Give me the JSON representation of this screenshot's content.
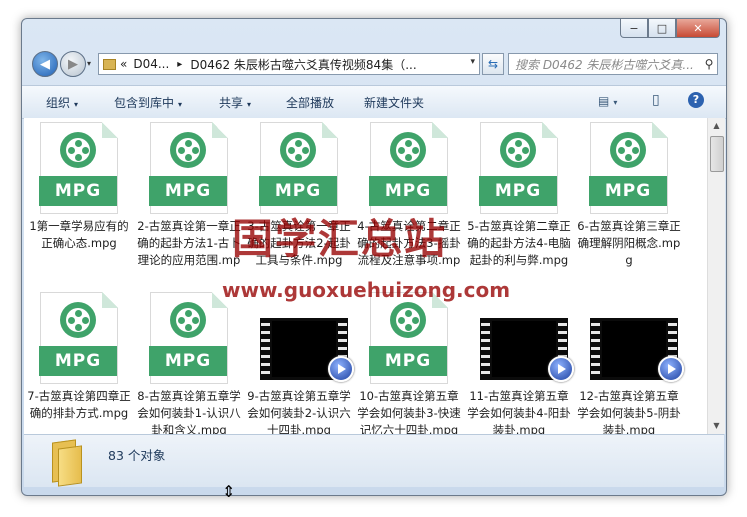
{
  "window": {
    "minimize": "−",
    "maximize": "□",
    "close": "✕"
  },
  "nav": {
    "back": "◀",
    "forward": "▶",
    "address_prefix": "«",
    "address_crumb1": "D04...",
    "address_sep": "▸",
    "address_crumb2": "D0462 朱辰彬古噬六爻真传视频84集（...",
    "address_dropdown": "▾",
    "refresh": "⇆",
    "search_placeholder": "搜索 D0462 朱辰彬古噬六爻真...",
    "search_icon": "magnifier-icon"
  },
  "toolbar": {
    "organize": "组织",
    "include_library": "包含到库中",
    "share": "共享",
    "play_all": "全部播放",
    "new_folder": "新建文件夹",
    "caret": "▾",
    "view_icon": "▤",
    "pane_icon": "▯",
    "help_icon": "?"
  },
  "files": [
    {
      "name": "1第一章学易应有的正确心态.mpg",
      "type": "MPG"
    },
    {
      "name": "2-古筮真诠第一章正确的起卦方法1-古卜理论的应用范围.mpg",
      "type": "MPG"
    },
    {
      "name": "3-古筮真诠第一章正确的起卦方法2-起卦工具与条件.mpg",
      "type": "MPG"
    },
    {
      "name": "4-古筮真诠第二章正确的起卦方法3-摇卦流程及注意事项.mpg",
      "type": "MPG"
    },
    {
      "name": "5-古筮真诠第二章正确的起卦方法4-电脑起卦的利与弊.mpg",
      "type": "MPG"
    },
    {
      "name": "6-古筮真诠第三章正确理解阴阳概念.mpg",
      "type": "MPG"
    },
    {
      "name": "7-古筮真诠第四章正确的排卦方式.mpg",
      "type": "MPG"
    },
    {
      "name": "8-古筮真诠第五章学会如何装卦1-认识八卦和含义.mpg",
      "type": "MPG"
    },
    {
      "name": "9-古筮真诠第五章学会如何装卦2-认识六十四卦.mpg",
      "type": "VIDEO"
    },
    {
      "name": "10-古筮真诠第五章学会如何装卦3-快速记忆六十四卦.mpg",
      "type": "MPG"
    },
    {
      "name": "11-古筮真诠第五章学会如何装卦4-阳卦装卦.mpg",
      "type": "VIDEO"
    },
    {
      "name": "12-古筮真诠第五章学会如何装卦5-阴卦装卦.mpg",
      "type": "VIDEO"
    }
  ],
  "status": {
    "count": "83 个对象"
  },
  "watermark": {
    "cn": "国学汇总站",
    "url": "www.guoxuehuizong.com"
  }
}
